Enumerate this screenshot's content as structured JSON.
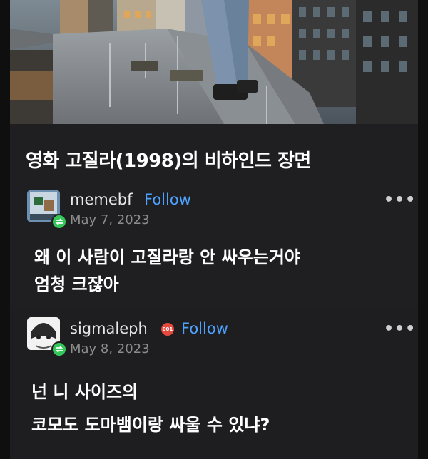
{
  "post": {
    "title": "영화 고질라(1998)의 비하인드 장면"
  },
  "comments": [
    {
      "username": "memebf",
      "follow_label": "Follow",
      "date": "May 7, 2023",
      "more_label": "•••",
      "text_lines": [
        "왜 이 사람이 고질라랑 안 싸우는거야",
        "엄청 크잖아"
      ]
    },
    {
      "username": "sigmaleph",
      "badge_text": "001",
      "follow_label": "Follow",
      "date": "May 8, 2023",
      "more_label": "•••",
      "text_lines": [
        "넌 니 사이즈의",
        "코모도 도마뱀이랑 싸울 수 있냐?"
      ]
    }
  ],
  "colors": {
    "background": "#0f0f0f",
    "card": "#1f1f21",
    "follow_blue": "#4da3ff",
    "date_gray": "#8d8d8d",
    "reblog_green": "#35c759"
  }
}
